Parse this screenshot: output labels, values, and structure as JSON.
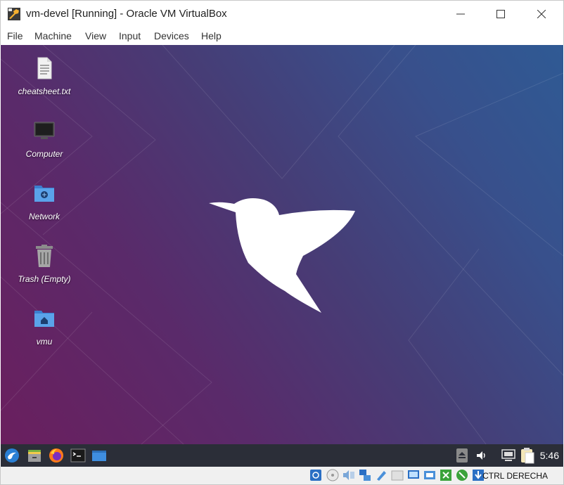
{
  "window": {
    "title": "vm-devel [Running] - Oracle VM VirtualBox"
  },
  "menu": [
    "File",
    "Machine",
    "View",
    "Input",
    "Devices",
    "Help"
  ],
  "desktop": {
    "icons": [
      {
        "label": "cheatsheet.txt",
        "icon": "text-file-icon"
      },
      {
        "label": "Computer",
        "icon": "computer-icon"
      },
      {
        "label": "Network",
        "icon": "network-folder-icon"
      },
      {
        "label": "Trash (Empty)",
        "icon": "trash-icon"
      },
      {
        "label": "vmu",
        "icon": "home-folder-icon"
      }
    ],
    "wallpaper_logo": "hummingbird-logo"
  },
  "taskbar": {
    "left_items": [
      "start-menu-icon",
      "file-manager-icon",
      "firefox-icon",
      "terminal-icon",
      "show-desktop-icon"
    ],
    "tray_items": [
      "eject-icon",
      "volume-icon",
      "display-icon",
      "clipboard-icon"
    ],
    "clock": "5:46"
  },
  "statusbar": {
    "icons": [
      "hard-disk-icon",
      "optical-drive-icon",
      "audio-icon",
      "network-icon",
      "usb-icon",
      "shared-folders-icon",
      "display-icon",
      "recording-icon",
      "cpu-icon",
      "mouse-integration-icon",
      "keyboard-capture-icon"
    ],
    "host_key": "CTRL DERECHA"
  },
  "colors": {
    "wallpaper_start": "#6a1f5e",
    "wallpaper_end": "#2f5a94",
    "taskbar": "#2b2e38",
    "folder_blue": "#4a90d9"
  }
}
